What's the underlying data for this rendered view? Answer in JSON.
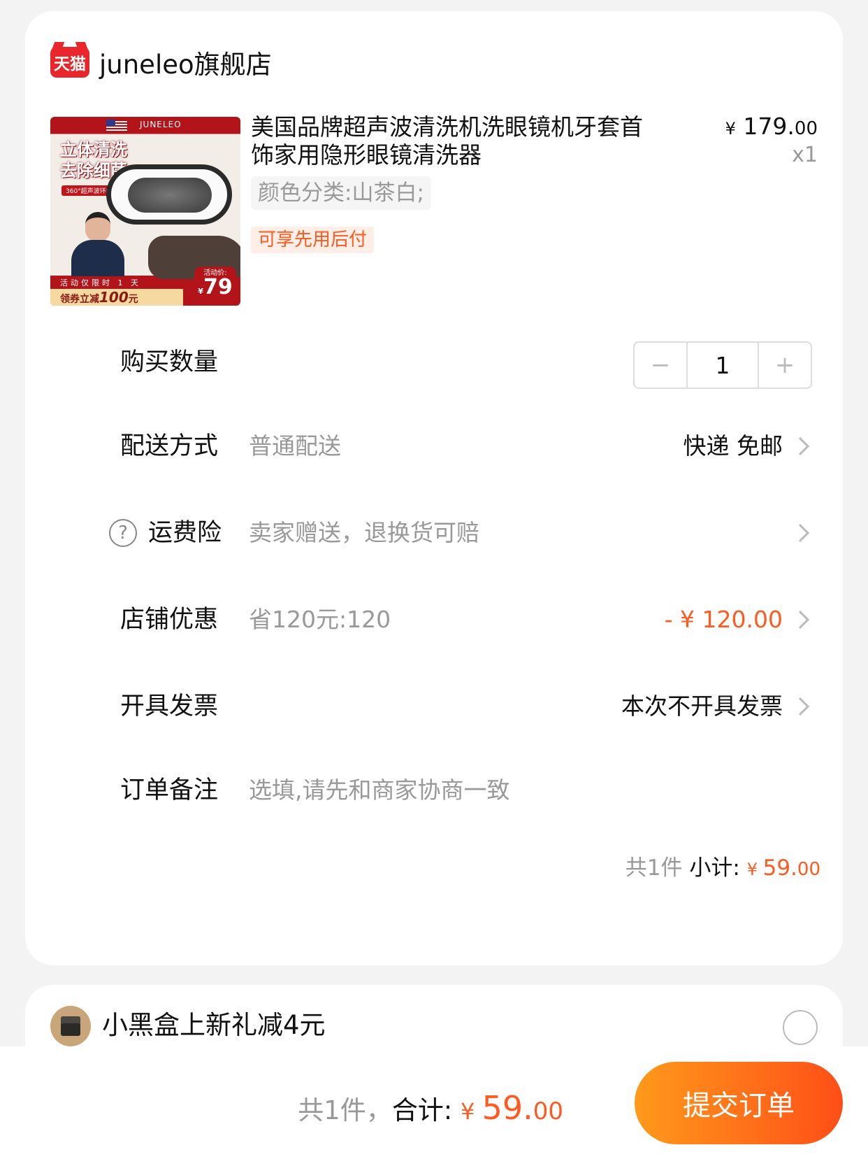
{
  "shop": {
    "logo_text": "天猫",
    "name": "juneleo旗舰店"
  },
  "product": {
    "image": {
      "brand": "JUNELEO",
      "headline": "立体清洗\n去除细菌",
      "tag": "360°超声波环绕",
      "promo_line1": "活动仅限时 1 天",
      "promo_line2_prefix": "领券立减",
      "promo_line2_value": "100",
      "promo_line2_unit": "元",
      "price_label": "活动价:",
      "price_currency": "¥",
      "price_value": "79"
    },
    "title": "美国品牌超声波清洗机洗眼镜机牙套首饰家用隐形眼镜清洗器",
    "price_currency": "¥",
    "price_int": " 179.",
    "price_dec": "00",
    "quantity_label": "x1",
    "sku": "颜色分类:山茶白;",
    "paylater": "可享先用后付"
  },
  "rows": {
    "quantity": {
      "label": "购买数量",
      "value": "1",
      "minus": "−",
      "plus": "+"
    },
    "delivery": {
      "label": "配送方式",
      "sub": "普通配送",
      "value": "快递 免邮"
    },
    "insurance": {
      "icon": "?",
      "label": "运费险",
      "sub": "卖家赠送，退换货可赔"
    },
    "discount": {
      "label": "店铺优惠",
      "sub": "省120元:120",
      "value": "- ¥ 120.00"
    },
    "invoice": {
      "label": "开具发票",
      "value": "本次不开具发票"
    },
    "remark": {
      "label": "订单备注",
      "placeholder": "选填,请先和商家协商一致"
    }
  },
  "subtotal": {
    "count": "共1件 ",
    "label": "小计: ",
    "currency": "¥ ",
    "int": "59.",
    "dec": "00"
  },
  "promo": {
    "label": "小黑盒上新礼减4元"
  },
  "footer": {
    "count": "共1件，",
    "label": "合计: ",
    "currency": "¥ ",
    "int": "59.",
    "dec": "00",
    "submit": "提交订单"
  },
  "colors": {
    "accent": "#ff5a1f",
    "tmall_red": "#e8262b",
    "button_gradient": [
      "#ff9a1b",
      "#ff4e18"
    ]
  }
}
